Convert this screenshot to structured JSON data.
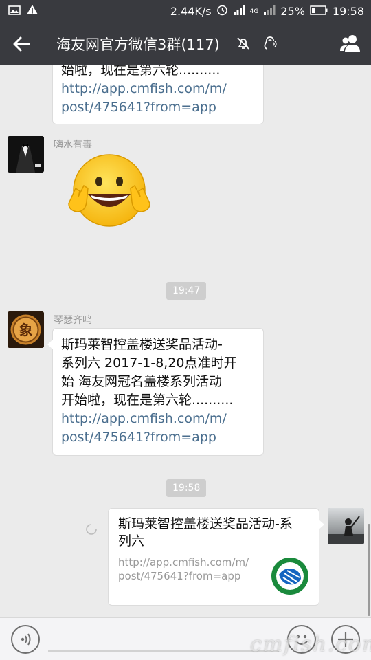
{
  "status_bar": {
    "net_speed": "2.44K/s",
    "network": "4G",
    "battery": "25%",
    "time": "19:58"
  },
  "header": {
    "title": "海友网官方微信3群(117)"
  },
  "messages": [
    {
      "type": "text",
      "lines_visible": [
        "始啦，现在是第六轮.........."
      ],
      "link": [
        "http://app.cmfish.com/m/",
        "post/475641?from=app"
      ]
    },
    {
      "type": "emoji",
      "sender": "嗨水有毒"
    },
    {
      "type": "time",
      "value": "19:47"
    },
    {
      "type": "text",
      "sender": "琴瑟齐鸣",
      "lines": [
        "斯玛莱智控盖楼送奖品活动-",
        "系列六 2017-1-8,20点准时开",
        "始 海友网冠名盖楼系列活动",
        "开始啦，现在是第六轮.........."
      ],
      "link": [
        "http://app.cmfish.com/m/",
        "post/475641?from=app"
      ]
    },
    {
      "type": "time",
      "value": "19:58"
    },
    {
      "type": "link_card",
      "title": [
        "斯玛莱智控盖楼送奖品活动-系",
        "列六"
      ],
      "desc": [
        "http://app.cmfish.com/m/",
        "post/475641?from=app"
      ]
    }
  ],
  "watermark": "cmfish.com",
  "colors": {
    "header_bg": "#393a3f",
    "chat_bg": "#ebebeb",
    "link": "#4a6e8e",
    "time_chip": "#cecece"
  }
}
